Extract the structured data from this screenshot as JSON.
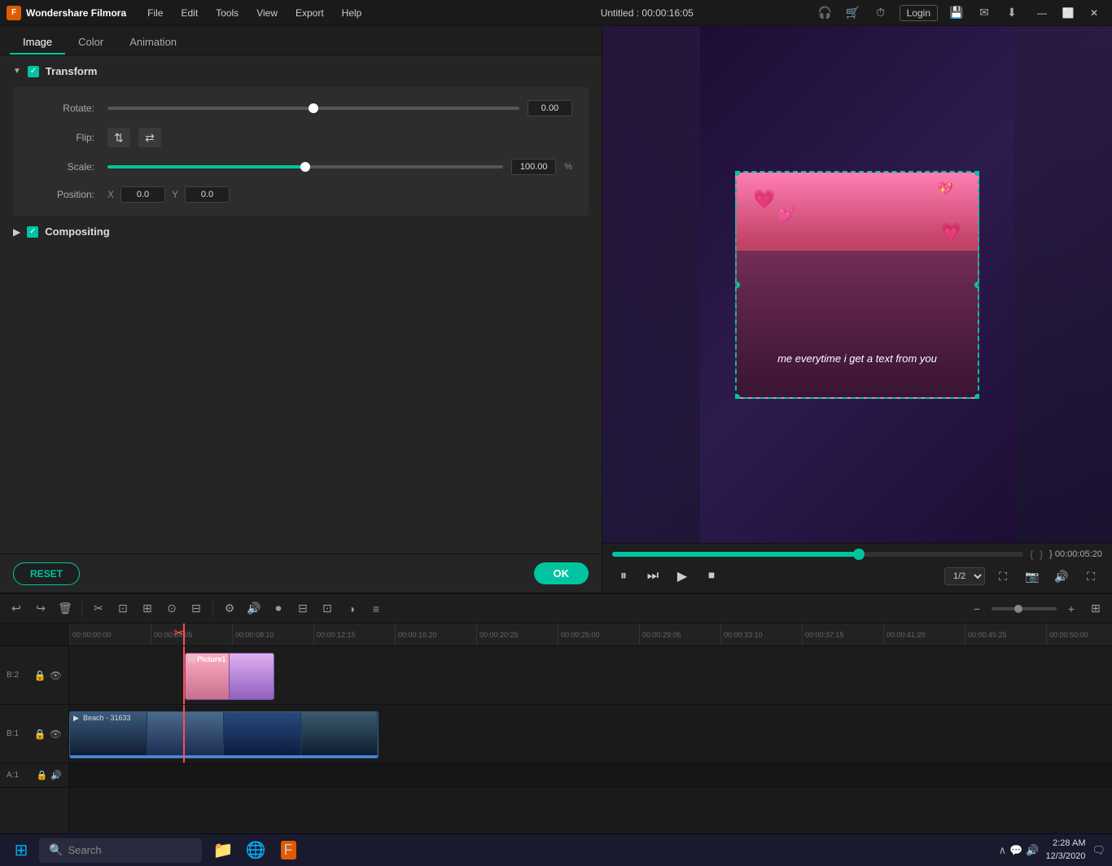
{
  "app": {
    "name": "Wondershare Filmora",
    "logo_char": "F",
    "title": "Untitled : 00:00:16:05"
  },
  "menu": {
    "items": [
      "File",
      "Edit",
      "Tools",
      "View",
      "Export",
      "Help"
    ]
  },
  "win_controls": {
    "minimize": "—",
    "maximize": "⬜",
    "close": "✕"
  },
  "header_icons": {
    "headset": "🎧",
    "cart": "🛒",
    "clock": "⏱",
    "login": "Login",
    "save": "💾",
    "mail": "✉",
    "download": "⬇"
  },
  "tabs": {
    "items": [
      "Image",
      "Color",
      "Animation"
    ],
    "active": "Image"
  },
  "transform": {
    "section_title": "Transform",
    "rotate_label": "Rotate:",
    "rotate_value": "0.00",
    "flip_label": "Flip:",
    "scale_label": "Scale:",
    "scale_value": "100.00",
    "scale_unit": "%",
    "position_label": "Position:",
    "pos_x_label": "X",
    "pos_x_value": "0.0",
    "pos_y_label": "Y",
    "pos_y_value": "0.0"
  },
  "compositing": {
    "section_title": "Compositing"
  },
  "buttons": {
    "reset": "RESET",
    "ok": "OK"
  },
  "playback": {
    "time_current": "{",
    "time_total": "} 00:00:05:20",
    "ratio": "1/2",
    "rewind_icon": "⏪",
    "step_back_icon": "⏮",
    "play_icon": "▶",
    "stop_icon": "⏹",
    "pause_step_icon": "⏭"
  },
  "timeline": {
    "ruler_marks": [
      "00:00:00:00",
      "00:00:04:05",
      "00:00:08:10",
      "00:00:12:15",
      "00:00:16:20",
      "00:00:20:25",
      "00:00:25:00",
      "00:00:29:05",
      "00:00:33:10",
      "00:00:37:15",
      "00:00:41:20",
      "00:00:45:25",
      "00:00:50:00"
    ],
    "track2_label": "🖼",
    "track1_label": "🎬",
    "clip_picture_name": "Picture1",
    "clip_video_name": "Beach - 31633",
    "playhead_time": "00:00:04:05"
  },
  "taskbar": {
    "search_placeholder": "Search",
    "time": "2:28 AM",
    "date": "12/3/2020",
    "win_logo": "⊞"
  },
  "video_caption": "me everytime i get\na text from you"
}
